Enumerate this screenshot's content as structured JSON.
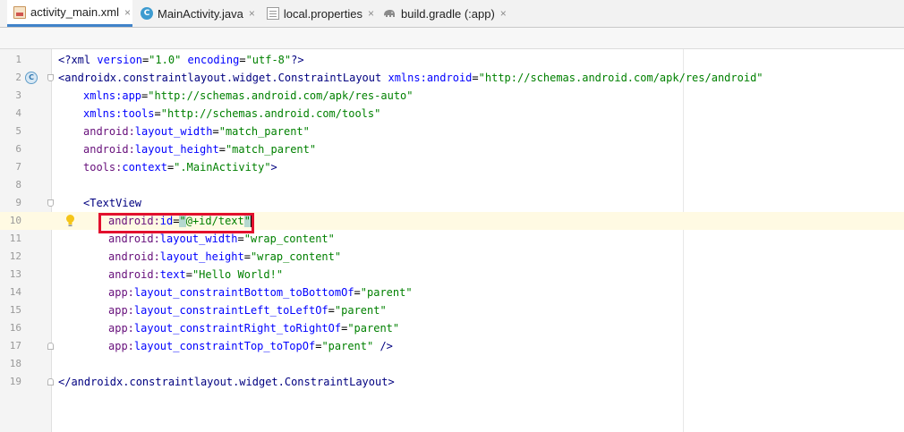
{
  "tabs": [
    {
      "label": "activity_main.xml",
      "icon": "xml-layout-icon",
      "active": true
    },
    {
      "label": "MainActivity.java",
      "icon": "java-class-icon",
      "icon_letter": "C",
      "active": false
    },
    {
      "label": "local.properties",
      "icon": "properties-file-icon",
      "active": false
    },
    {
      "label": "build.gradle (:app)",
      "icon": "gradle-elephant-icon",
      "active": false
    }
  ],
  "close_glyph": "×",
  "gutter": {
    "line_numbers": [
      "1",
      "2",
      "3",
      "4",
      "5",
      "6",
      "7",
      "8",
      "9",
      "10",
      "11",
      "12",
      "13",
      "14",
      "15",
      "16",
      "17",
      "18",
      "19"
    ],
    "class_icon_letter": "C"
  },
  "code": {
    "l1": {
      "pi_open": "<?xml ",
      "a1": "version",
      "eq1": "=",
      "v1": "\"1.0\"",
      "sp": " ",
      "a2": "encoding",
      "eq2": "=",
      "v2": "\"utf-8\"",
      "pi_close": "?>"
    },
    "l2": {
      "tag": "<androidx.constraintlayout.widget.ConstraintLayout ",
      "ns": "xmlns:",
      "attr": "android",
      "eq": "=",
      "val": "\"http://schemas.android.com/apk/res/android\""
    },
    "l3": {
      "ns": "xmlns:",
      "attr": "app",
      "eq": "=",
      "val": "\"http://schemas.android.com/apk/res-auto\""
    },
    "l4": {
      "ns": "xmlns:",
      "attr": "tools",
      "eq": "=",
      "val": "\"http://schemas.android.com/tools\""
    },
    "l5": {
      "ns": "android:",
      "attr": "layout_width",
      "eq": "=",
      "val": "\"match_parent\""
    },
    "l6": {
      "ns": "android:",
      "attr": "layout_height",
      "eq": "=",
      "val": "\"match_parent\""
    },
    "l7": {
      "ns": "tools:",
      "attr": "context",
      "eq": "=",
      "val": "\".MainActivity\"",
      "close": ">"
    },
    "l9": {
      "tag": "<TextView"
    },
    "l10": {
      "ns": "android:",
      "attr": "id",
      "eq": "=",
      "q1": "\"",
      "val": "@+id/text",
      "q2": "\""
    },
    "l11": {
      "ns": "android:",
      "attr": "layout_width",
      "eq": "=",
      "val": "\"wrap_content\""
    },
    "l12": {
      "ns": "android:",
      "attr": "layout_height",
      "eq": "=",
      "val": "\"wrap_content\""
    },
    "l13": {
      "ns": "android:",
      "attr": "text",
      "eq": "=",
      "val": "\"Hello World!\""
    },
    "l14": {
      "ns": "app:",
      "attr": "layout_constraintBottom_toBottomOf",
      "eq": "=",
      "val": "\"parent\""
    },
    "l15": {
      "ns": "app:",
      "attr": "layout_constraintLeft_toLeftOf",
      "eq": "=",
      "val": "\"parent\""
    },
    "l16": {
      "ns": "app:",
      "attr": "layout_constraintRight_toRightOf",
      "eq": "=",
      "val": "\"parent\""
    },
    "l17": {
      "ns": "app:",
      "attr": "layout_constraintTop_toTopOf",
      "eq": "=",
      "val": "\"parent\"",
      "close": " />"
    },
    "l19": {
      "tag": "</androidx.constraintlayout.widget.ConstraintLayout>"
    }
  },
  "colors": {
    "tag": "#000080",
    "attribute": "#0000ff",
    "namespace": "#660e7a",
    "value": "#008000",
    "current_line": "#fffae3",
    "highlight_box": "#e2102d",
    "active_tab_underline": "#4083c9"
  }
}
